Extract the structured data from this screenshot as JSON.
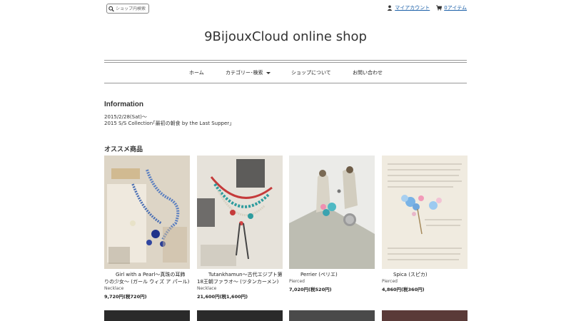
{
  "search": {
    "placeholder": "ショップ内検索"
  },
  "account": {
    "my_account": "マイアカウント",
    "cart": "0アイテム"
  },
  "shop_title": "9BijouxCloud online shop",
  "nav": {
    "home": "ホーム",
    "category": "カテゴリー･検索",
    "about": "ショップについて",
    "contact": "お問い合わせ"
  },
  "information": {
    "heading": "Information",
    "line1": "2015/2/28(Sat)～",
    "line2": "2015 S/S Collection｢最初の朝食 by the Last Supper｣"
  },
  "recommended": {
    "heading": "オススメ商品",
    "products": [
      {
        "name": "Girl with a Pearl～真珠の耳飾りの少女～ (ガール ウィズ ア パール)",
        "category": "Necklace",
        "price": "9,720円(税720円)"
      },
      {
        "name": "Tutankhamun～古代エジプト第18王朝ファラオ～ (ツタンカーメン)",
        "category": "Necklace",
        "price": "21,600円(税1,600円)"
      },
      {
        "name": "Perrier (ペリエ)",
        "category": "Pierced",
        "price": "7,020円(税520円)"
      },
      {
        "name": "Spica (スピカ)",
        "category": "Pierced",
        "price": "4,860円(税360円)"
      }
    ]
  },
  "colors": {
    "link": "#1a5fa8",
    "rule": "#999999",
    "text": "#333333"
  },
  "icons": {
    "search": "search-icon",
    "account": "user-icon",
    "cart": "cart-icon"
  }
}
